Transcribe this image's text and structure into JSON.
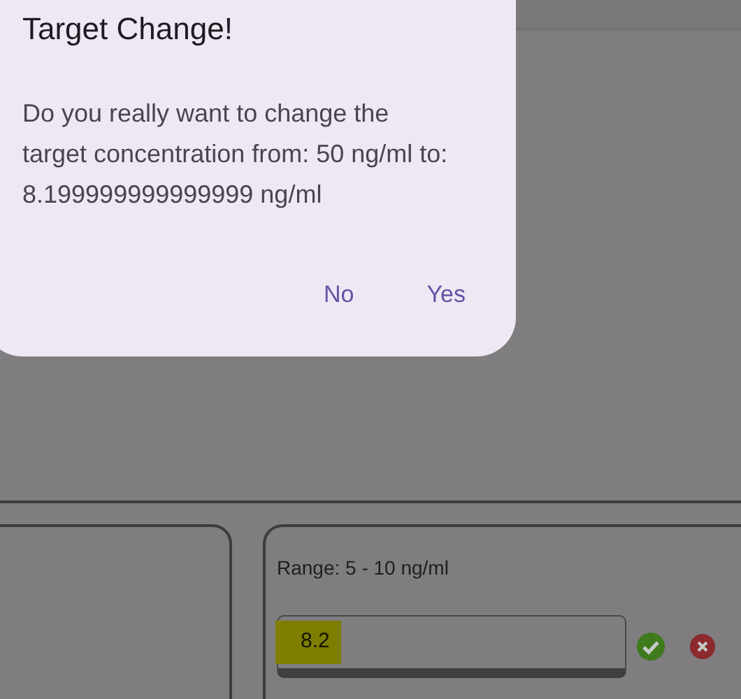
{
  "dialog": {
    "title": "Target Change!",
    "message": "Do you really want to change the target concentration from: 50 ng/ml to: 8.199999999999999 ng/ml",
    "buttons": [
      {
        "label": "No"
      },
      {
        "label": "Yes"
      }
    ]
  },
  "target_panel": {
    "range_label": "Range: 5 - 10 ng/ml",
    "input": {
      "value": "8.2",
      "highlighted": true
    }
  }
}
